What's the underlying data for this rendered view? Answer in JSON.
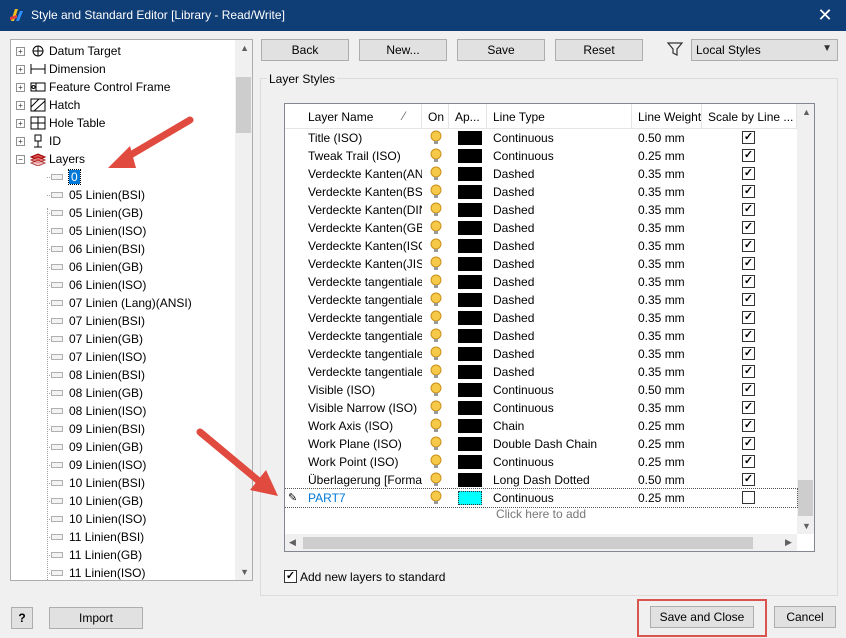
{
  "window": {
    "title": "Style and Standard Editor [Library - Read/Write]"
  },
  "tree": {
    "parents": [
      {
        "label": "Datum Target",
        "icon": "datum-target-icon",
        "expander": "+"
      },
      {
        "label": "Dimension",
        "icon": "dimension-icon",
        "expander": "+"
      },
      {
        "label": "Feature Control Frame",
        "icon": "feature-control-frame-icon",
        "expander": "+"
      },
      {
        "label": "Hatch",
        "icon": "hatch-icon",
        "expander": "+"
      },
      {
        "label": "Hole Table",
        "icon": "hole-table-icon",
        "expander": "+"
      },
      {
        "label": "ID",
        "icon": "id-icon",
        "expander": "+"
      },
      {
        "label": "Layers",
        "icon": "layers-icon",
        "expander": "−"
      }
    ],
    "layers": [
      "0",
      "05 Linien(BSI)",
      "05 Linien(GB)",
      "05 Linien(ISO)",
      "06 Linien(BSI)",
      "06 Linien(GB)",
      "06 Linien(ISO)",
      "07 Linien (Lang)(ANSI)",
      "07 Linien(BSI)",
      "07 Linien(GB)",
      "07 Linien(ISO)",
      "08 Linien(BSI)",
      "08 Linien(GB)",
      "08 Linien(ISO)",
      "09 Linien(BSI)",
      "09 Linien(GB)",
      "09 Linien(ISO)",
      "10 Linien(BSI)",
      "10 Linien(GB)",
      "10 Linien(ISO)",
      "11 Linien(BSI)",
      "11 Linien(GB)",
      "11 Linien(ISO)"
    ]
  },
  "toolbar": {
    "back": "Back",
    "new": "New...",
    "save": "Save",
    "reset": "Reset",
    "filter_value": "Local Styles"
  },
  "group_title": "Layer Styles",
  "table": {
    "columns": [
      "Layer Name",
      "On",
      "Ap...",
      "Line Type",
      "Line Weight",
      "Scale by Line ..."
    ],
    "rows": [
      {
        "name": "Title (ISO)",
        "linetype": "Continuous",
        "weight": "0.50 mm",
        "checked": true
      },
      {
        "name": "Tweak Trail (ISO)",
        "linetype": "Continuous",
        "weight": "0.25 mm",
        "checked": true
      },
      {
        "name": "Verdeckte Kanten(ANSI)",
        "linetype": "Dashed",
        "weight": "0.35 mm",
        "checked": true
      },
      {
        "name": "Verdeckte Kanten(BSI)",
        "linetype": "Dashed",
        "weight": "0.35 mm",
        "checked": true
      },
      {
        "name": "Verdeckte Kanten(DIN)",
        "linetype": "Dashed",
        "weight": "0.35 mm",
        "checked": true
      },
      {
        "name": "Verdeckte Kanten(GB)",
        "linetype": "Dashed",
        "weight": "0.35 mm",
        "checked": true
      },
      {
        "name": "Verdeckte Kanten(ISO)",
        "linetype": "Dashed",
        "weight": "0.35 mm",
        "checked": true
      },
      {
        "name": "Verdeckte Kanten(JIS)",
        "linetype": "Dashed",
        "weight": "0.35 mm",
        "checked": true
      },
      {
        "name": "Verdeckte tangentiale K",
        "linetype": "Dashed",
        "weight": "0.35 mm",
        "checked": true
      },
      {
        "name": "Verdeckte tangentiale K",
        "linetype": "Dashed",
        "weight": "0.35 mm",
        "checked": true
      },
      {
        "name": "Verdeckte tangentiale K",
        "linetype": "Dashed",
        "weight": "0.35 mm",
        "checked": true
      },
      {
        "name": "Verdeckte tangentiale K",
        "linetype": "Dashed",
        "weight": "0.35 mm",
        "checked": true
      },
      {
        "name": "Verdeckte tangentiale K",
        "linetype": "Dashed",
        "weight": "0.35 mm",
        "checked": true
      },
      {
        "name": "Verdeckte tangentiale K",
        "linetype": "Dashed",
        "weight": "0.35 mm",
        "checked": true
      },
      {
        "name": "Visible (ISO)",
        "linetype": "Continuous",
        "weight": "0.50 mm",
        "checked": true
      },
      {
        "name": "Visible Narrow (ISO)",
        "linetype": "Continuous",
        "weight": "0.35 mm",
        "checked": true
      },
      {
        "name": "Work Axis (ISO)",
        "linetype": "Chain",
        "weight": "0.25 mm",
        "checked": true
      },
      {
        "name": "Work Plane (ISO)",
        "linetype": "Double Dash Chain",
        "weight": "0.25 mm",
        "checked": true
      },
      {
        "name": "Work Point (ISO)",
        "linetype": "Continuous",
        "weight": "0.25 mm",
        "checked": true
      },
      {
        "name": "Überlagerung [Formatvo",
        "linetype": "Long Dash Dotted",
        "weight": "0.50 mm",
        "checked": true
      },
      {
        "name": "PART7",
        "linetype": "Continuous",
        "weight": "0.25 mm",
        "checked": false,
        "new": true
      }
    ],
    "click_to_add": "Click here to add"
  },
  "add_to_standard": "Add new layers to standard",
  "footer": {
    "help": "?",
    "import": "Import",
    "save_close": "Save and Close",
    "cancel": "Cancel"
  },
  "colors": {
    "title_bar": "#0f3d76",
    "accent": "#0078d7",
    "annotation_red": "#e04a3f"
  }
}
